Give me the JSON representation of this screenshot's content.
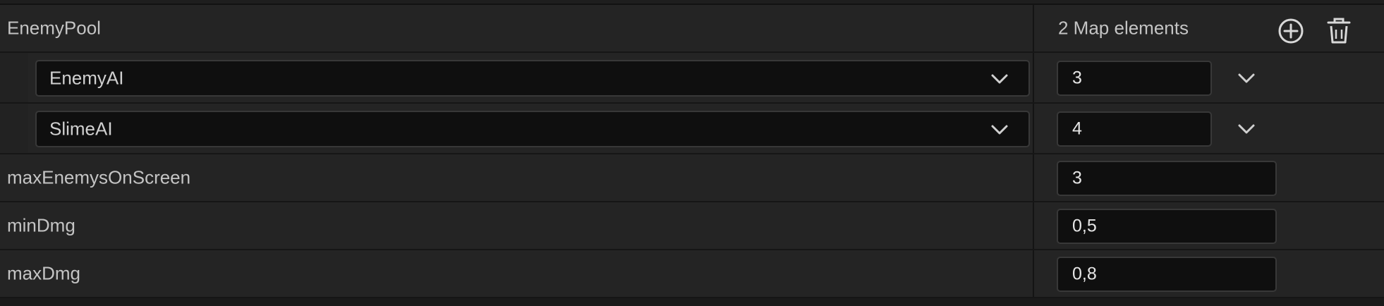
{
  "properties": {
    "enemy_pool": {
      "label": "EnemyPool",
      "summary": "2 Map elements",
      "add_icon": "plus-circle-icon",
      "delete_icon": "trash-icon",
      "entries": [
        {
          "key": "EnemyAI",
          "value": "3"
        },
        {
          "key": "SlimeAI",
          "value": "4"
        }
      ]
    },
    "max_enemys_on_screen": {
      "label": "maxEnemysOnScreen",
      "value": "3"
    },
    "min_dmg": {
      "label": "minDmg",
      "value": "0,5"
    },
    "max_dmg": {
      "label": "maxDmg",
      "value": "0,8"
    }
  },
  "colors": {
    "background": "#242424",
    "field": "#0f0f0f",
    "border": "#383838",
    "text": "#c4c4c4"
  }
}
